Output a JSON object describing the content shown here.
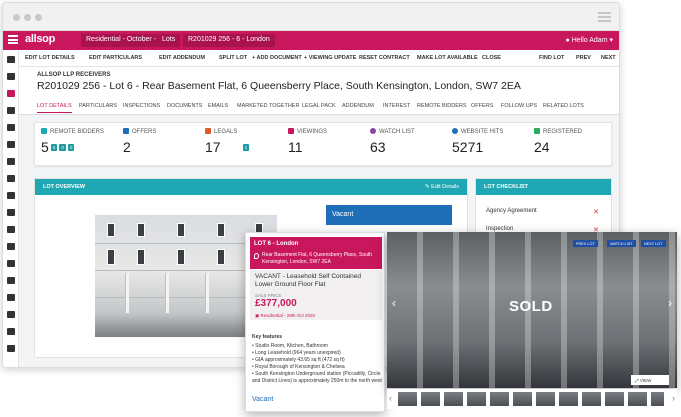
{
  "appbar": {
    "logo": "allsop",
    "breadcrumbs": [
      "Residential - October - 2020",
      "Lots",
      "R201029 256 - 6 - London"
    ],
    "user": "Hello Adam"
  },
  "toolbar": {
    "items": [
      "EDIT LOT DETAILS",
      "EDIT PARTICULARS",
      "EDIT ADDENDUM",
      "SPLIT LOT",
      "+ ADD DOCUMENT",
      "+ VIEWING UPDATE",
      "RESET CONTRACT",
      "MAKE LOT AVAILABLE",
      "CLOSE",
      "FIND LOT",
      "PREV",
      "NEXT"
    ]
  },
  "header": {
    "receivers": "ALLSOP LLP RECEIVERS",
    "title": "R201029 256 - Lot 6 - Rear Basement Flat, 6 Queensberry Place, South Kensington, London, SW7 2EA"
  },
  "tabs": [
    "LOT DETAILS",
    "PARTICULARS",
    "INSPECTIONS",
    "DOCUMENTS",
    "EMAILS",
    "MARKETED TOGETHER",
    "LEGAL PACK",
    "ADDENDUM",
    "INTEREST",
    "REMOTE BIDDERS",
    "OFFERS",
    "FOLLOW UPS",
    "RELATED LOTS"
  ],
  "stats": [
    {
      "label": "REMOTE BIDDERS",
      "value": "5",
      "color": "#1fa7b3",
      "pills": [
        "5",
        "0",
        "0"
      ]
    },
    {
      "label": "OFFERS",
      "value": "2",
      "color": "#1f6fb8",
      "pills": []
    },
    {
      "label": "LEGALS",
      "value": "17",
      "color": "#e05a2a",
      "pills": [
        "1"
      ]
    },
    {
      "label": "VIEWINGS",
      "value": "11",
      "color": "#c8175d",
      "pills": []
    },
    {
      "label": "WATCH LIST",
      "value": "63",
      "color": "#8e44ad",
      "pills": []
    },
    {
      "label": "WEBSITE HITS",
      "value": "5271",
      "color": "#1f6fb8",
      "pills": []
    },
    {
      "label": "REGISTERED",
      "value": "24",
      "color": "#27ae60",
      "pills": []
    }
  ],
  "overview": {
    "title": "LOT OVERVIEW",
    "edit": "Edit Details",
    "status": "Vacant"
  },
  "checklist": {
    "title": "LOT CHECKLIST",
    "items": [
      "Agency Agreement",
      "Inspection"
    ]
  },
  "card": {
    "lot": "LOT 6 - London",
    "address": "Rear Basement Flat, 6 Queensberry Place, South Kensington, London, SW7 2EA",
    "description": "VACANT - Leasehold Self Contained Lower Ground Floor Flat",
    "sale_price_label": "SALE PRICE",
    "price": "£377,000",
    "auction": "Residential - 29th Oct 2020",
    "features_title": "Key features",
    "features": [
      "Studio Room, Kitchen, Bathroom",
      "Long Leasehold (964 years unexpired)",
      "GIA approximately 43.65 sq ft (472 sq ft)",
      "Royal Borough of Kensington & Chelsea",
      "South Kensington Underground station (Piccadilly, Circle and District Lines) is approximately 250m to the north west"
    ],
    "status": "Vacant"
  },
  "photo": {
    "overlay": "SOLD",
    "buttons": [
      "PREV LOT",
      "WATCH LIST",
      "NEXT LOT"
    ],
    "view_label": "VIEW"
  }
}
